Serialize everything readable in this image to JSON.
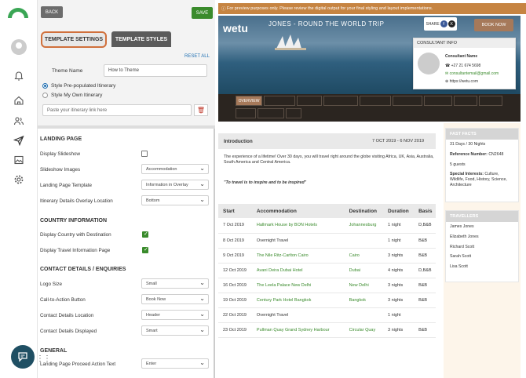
{
  "editor": {
    "back_label": "BACK",
    "save_label": "SAVE",
    "tab_settings": "TEMPLATE SETTINGS",
    "tab_styles": "TEMPLATE STYLES",
    "reset_all": "RESET ALL",
    "theme_label": "Theme Name",
    "theme_value": "How to Theme",
    "radio_prepopulated": "Style Pre-populated Itinerary",
    "radio_own": "Style My Own Itinerary",
    "itinerary_link_placeholder": "Paste your itinerary link here",
    "sections": {
      "landing": "LANDING PAGE",
      "country": "COUNTRY INFORMATION",
      "contact": "CONTACT DETAILS / ENQUIRIES",
      "general": "GENERAL"
    },
    "rows": {
      "display_slideshow": "Display Slideshow",
      "slideshow_images": "Slideshow Images",
      "slideshow_images_value": "Accommodation",
      "landing_template": "Landing Page Template",
      "landing_template_value": "Information in Overlay",
      "overlay_location": "Itinerary Details Overlay Location",
      "overlay_location_value": "Bottom",
      "country_with_dest": "Display Country with Destination",
      "travel_info_page": "Display Travel Information Page",
      "logo_size": "Logo Size",
      "logo_size_value": "Small",
      "cta_button": "Call-to-Action Button",
      "cta_button_value": "Book Now",
      "contact_location": "Contact Details Location",
      "contact_location_value": "Header",
      "contact_displayed": "Contact Details Displayed",
      "contact_displayed_value": "Smart",
      "proceed_action": "Landing Page Proceed Action Text",
      "proceed_action_value": "Enter"
    }
  },
  "preview": {
    "notice": "For preview purposes only. Please review the digital output for your final styling and layout implementations.",
    "brand": "wetu",
    "trip_title": "JONES - ROUND THE WORLD TRIP",
    "share_label": "SHARE",
    "book_now": "BOOK NOW",
    "consultant": {
      "header": "CONSULTANT INFO",
      "name": "Consultant Name",
      "phone": "+27 21 674 5698",
      "email": "consultantemail@gmail.com",
      "web": "https://wetu.com"
    },
    "overview_tab": "OVERVIEW",
    "intro_title": "Introduction",
    "intro_dates": "7 OCT 2019 - 6 NOV 2019",
    "intro_text": "The experience of a lifetime! Over 30 days, you will travel right around the globe visiting Africa, UK, Asia, Australia, South America and Central America.",
    "intro_quote": "\"To travel is to inspire and to be inspired\"",
    "table_headers": [
      "Start",
      "Accommodation",
      "Destination",
      "Duration",
      "Basis"
    ],
    "table_rows": [
      {
        "start": "7 Oct 2019",
        "acc": "Hallmark House by BON Hotels",
        "dest": "Johannesburg",
        "dur": "1 night",
        "basis": "D,B&B"
      },
      {
        "start": "8 Oct 2019",
        "acc": "Overnight Travel",
        "dest": "",
        "dur": "1 night",
        "basis": "B&B"
      },
      {
        "start": "9 Oct 2019",
        "acc": "The Nile Ritz-Carlton Cairo",
        "dest": "Cairo",
        "dur": "3 nights",
        "basis": "B&B"
      },
      {
        "start": "12 Oct 2019",
        "acc": "Avani Deira Dubai Hotel",
        "dest": "Dubai",
        "dur": "4 nights",
        "basis": "D,B&B"
      },
      {
        "start": "16 Oct 2019",
        "acc": "The Leela Palace New Delhi",
        "dest": "New Delhi",
        "dur": "3 nights",
        "basis": "B&B"
      },
      {
        "start": "19 Oct 2019",
        "acc": "Century Park Hotel Bangkok",
        "dest": "Bangkok",
        "dur": "3 nights",
        "basis": "B&B"
      },
      {
        "start": "22 Oct 2019",
        "acc": "Overnight Travel",
        "dest": "",
        "dur": "1 night",
        "basis": ""
      },
      {
        "start": "23 Oct 2019",
        "acc": "Pullman Quay Grand Sydney Harbour",
        "dest": "Circular Quay",
        "dur": "3 nights",
        "basis": "B&B"
      }
    ],
    "fast_facts": {
      "header": "FAST FACTS",
      "duration": "31 Days / 30 Nights",
      "reference_label": "Reference Number:",
      "reference": "CN2648",
      "guests": "5 guests",
      "interests_label": "Special Interests:",
      "interests": "Culture, Wildlife, Food, History, Science, Architecture"
    },
    "travellers": {
      "header": "TRAVELLERS",
      "names": [
        "James Jones",
        "Elizabeth Jones",
        "Richard Scott",
        "Sarah Scott",
        "Lisa Scott"
      ]
    }
  }
}
